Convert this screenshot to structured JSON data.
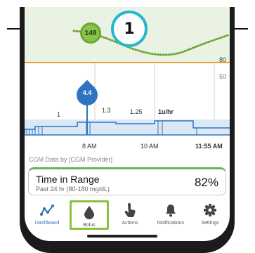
{
  "callout": {
    "number": "1"
  },
  "chart": {
    "glucose_marker_value": "148",
    "high_limit_label": "80",
    "insulin_scale_label": "50",
    "bolus_value": "4.4",
    "basal_rates": [
      "1",
      "1.3",
      "1.25",
      "1u/hr"
    ],
    "time_labels": [
      "8 AM",
      "10 AM",
      "11:55 AM"
    ],
    "colors": {
      "target_band": "#eaf2e3",
      "glucose_trace": "#6fa537",
      "high_limit": "#e8a13a",
      "insulin": "#2f74c0"
    }
  },
  "cgm_source": "CGM Data by [CGM Provider]",
  "time_in_range": {
    "title": "Time in Range",
    "subtitle": "Past 24 hr (80-180 mg/dL)",
    "value": "82%"
  },
  "nav": {
    "items": [
      {
        "label": "Dashboard",
        "icon": "dashboard-trend-icon"
      },
      {
        "label": "Bolus",
        "icon": "drop-icon"
      },
      {
        "label": "Actions",
        "icon": "hand-pointer-icon"
      },
      {
        "label": "Notifications",
        "icon": "bell-icon"
      },
      {
        "label": "Settings",
        "icon": "gear-icon"
      }
    ]
  }
}
